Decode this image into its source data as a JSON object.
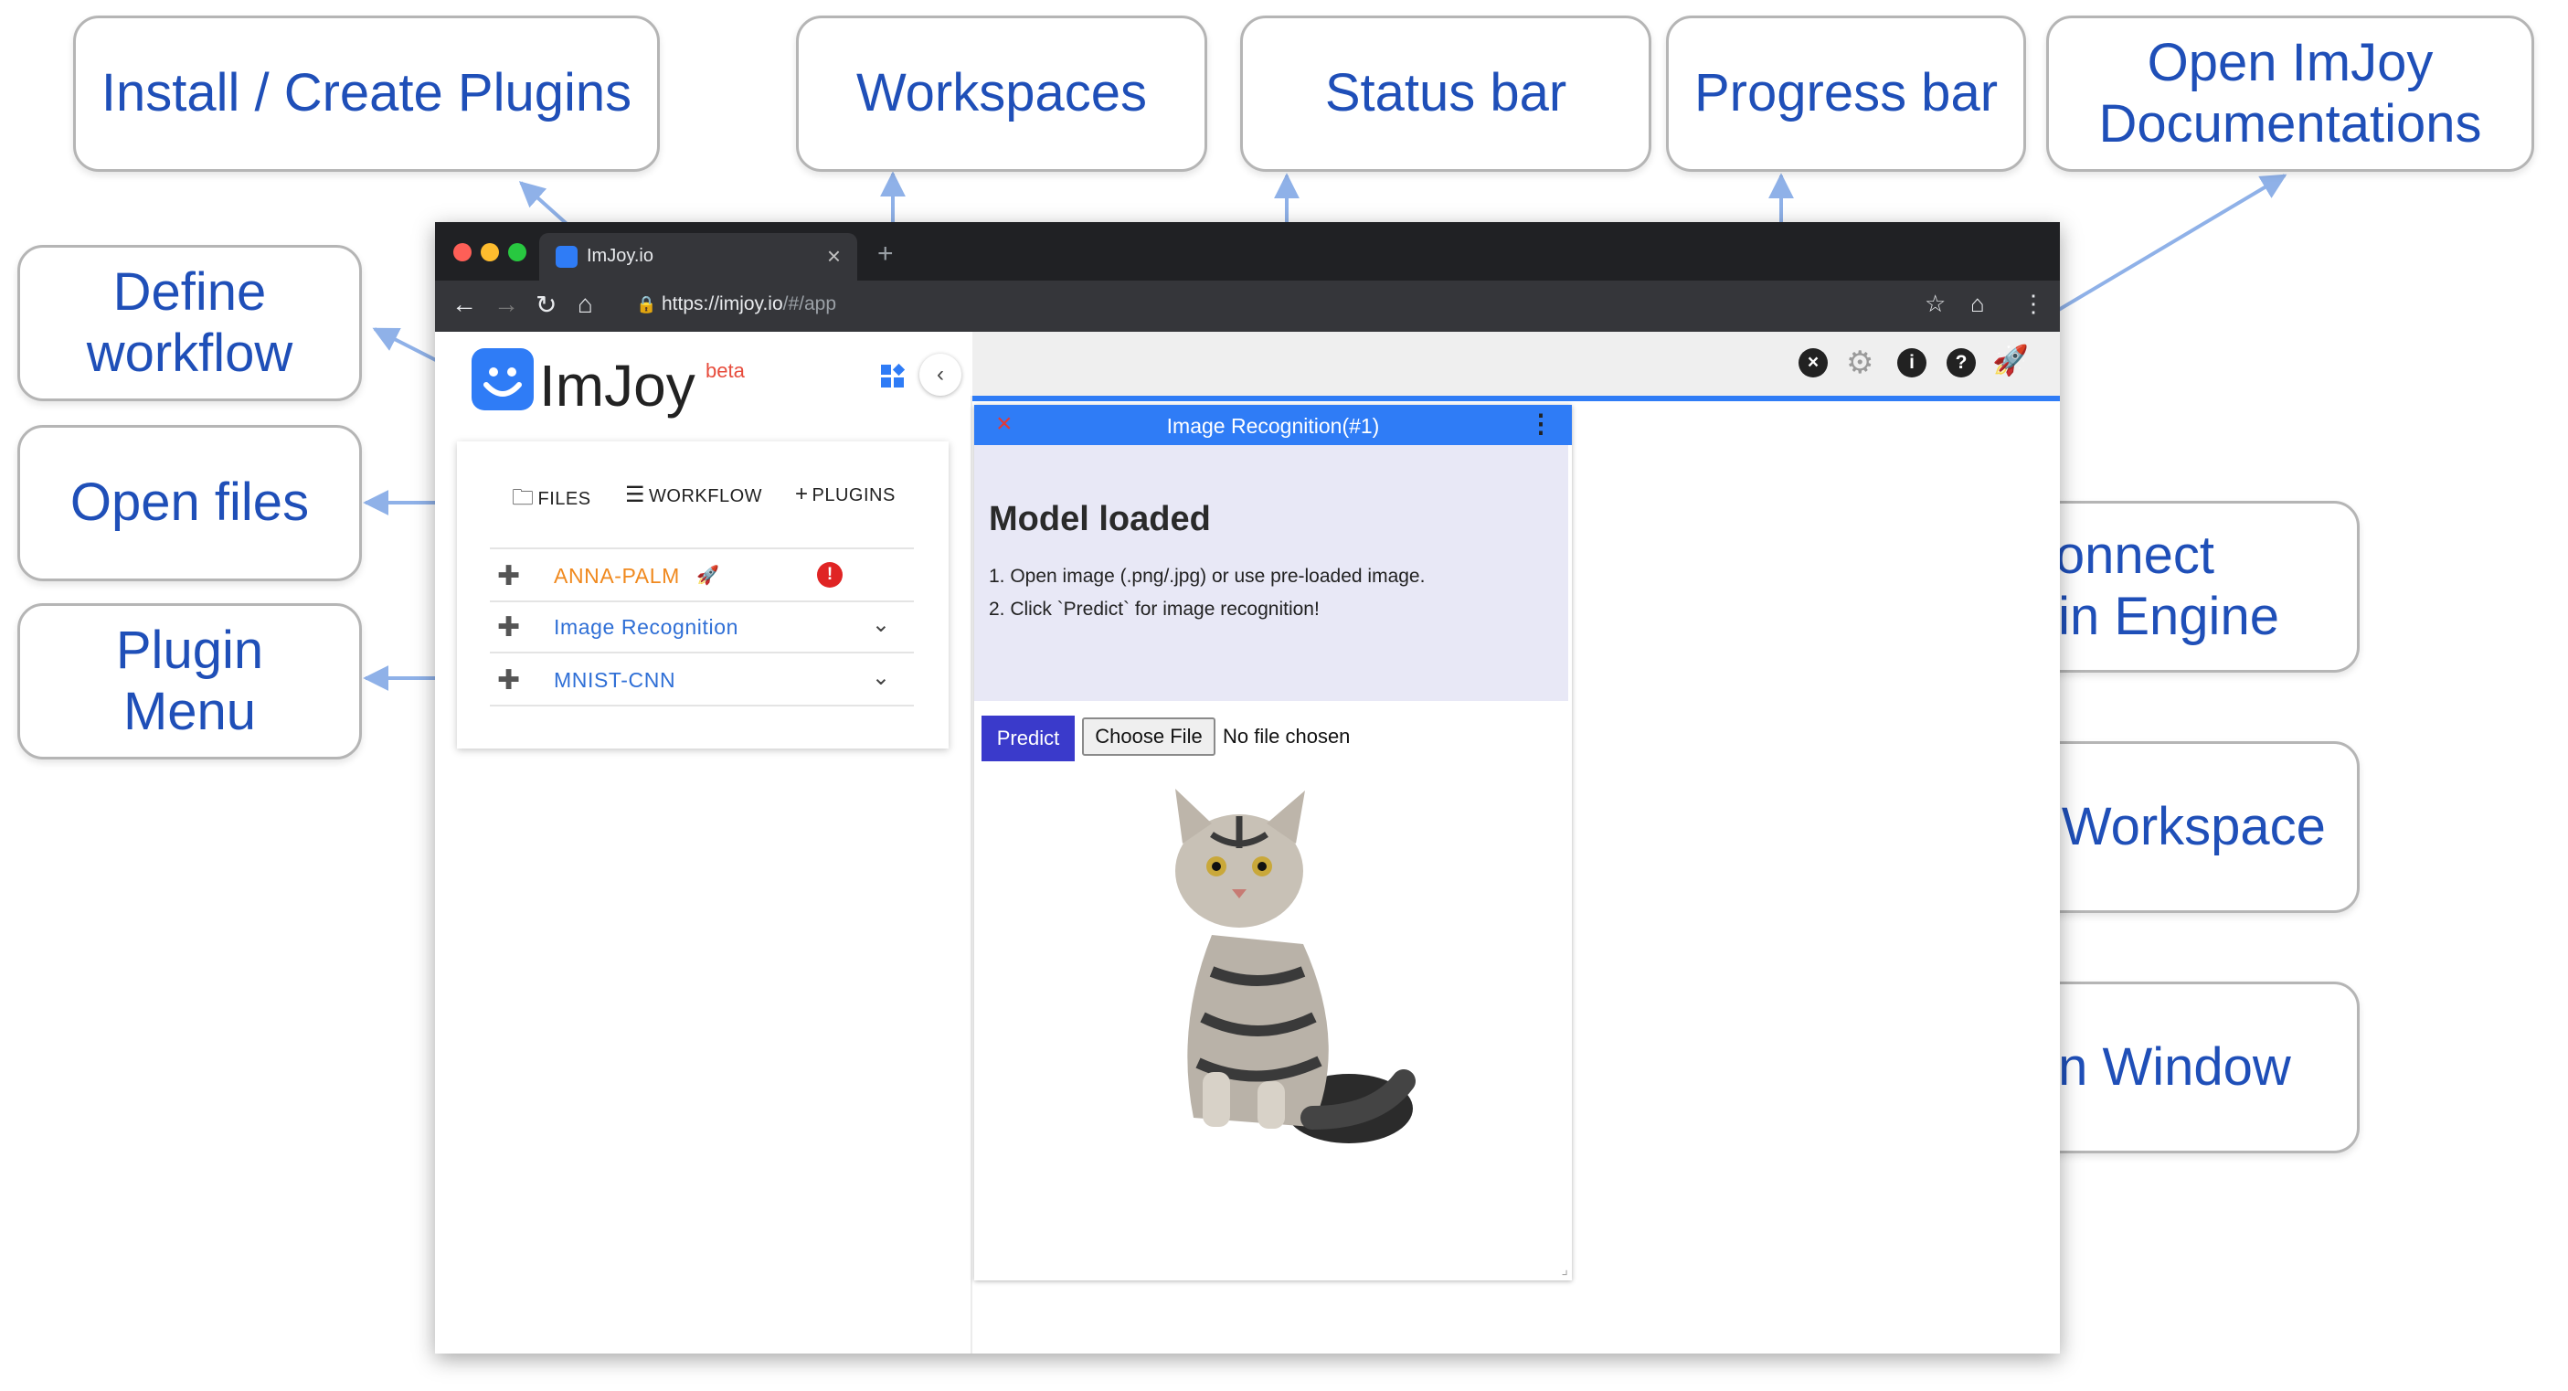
{
  "callouts": {
    "install_plugins": "Install / Create Plugins",
    "workspaces": "Workspaces",
    "status_bar": "Status bar",
    "progress_bar": "Progress bar",
    "open_docs": "Open ImJoy\nDocumentations",
    "define_workflow": "Define\nworkflow",
    "open_files": "Open files",
    "plugin_menu": "Plugin\nMenu",
    "connect_engine": "Connect\nPlugin Engine",
    "imjoy_workspace": "ImJoy Workspace",
    "plugin_window": "Plugin Window"
  },
  "browser": {
    "tab_title": "ImJoy.io",
    "url_host": "https://imjoy.io",
    "url_path": "/#/app"
  },
  "app": {
    "logo_text": "ImJoy",
    "beta": "beta",
    "menu": {
      "files": "FILES",
      "workflow": "WORKFLOW",
      "plugins": "PLUGINS"
    },
    "plugins": [
      {
        "name": "ANNA-PALM",
        "color": "#f0891e"
      },
      {
        "name": "Image Recognition",
        "color": "#2f6fd6"
      },
      {
        "name": "MNIST-CNN",
        "color": "#2f6fd6"
      }
    ]
  },
  "plugin_window": {
    "title": "Image Recognition(#1)",
    "heading": "Model loaded",
    "step1": "1. Open image (.png/.jpg) or use pre-loaded image.",
    "step2": "2. Click `Predict` for image recognition!",
    "predict": "Predict",
    "choose_file": "Choose File",
    "no_file": "No file chosen"
  },
  "colors": {
    "accent": "#2f7cf6",
    "callout_text": "#1f4fb8",
    "arrow": "#8fb1e8"
  }
}
